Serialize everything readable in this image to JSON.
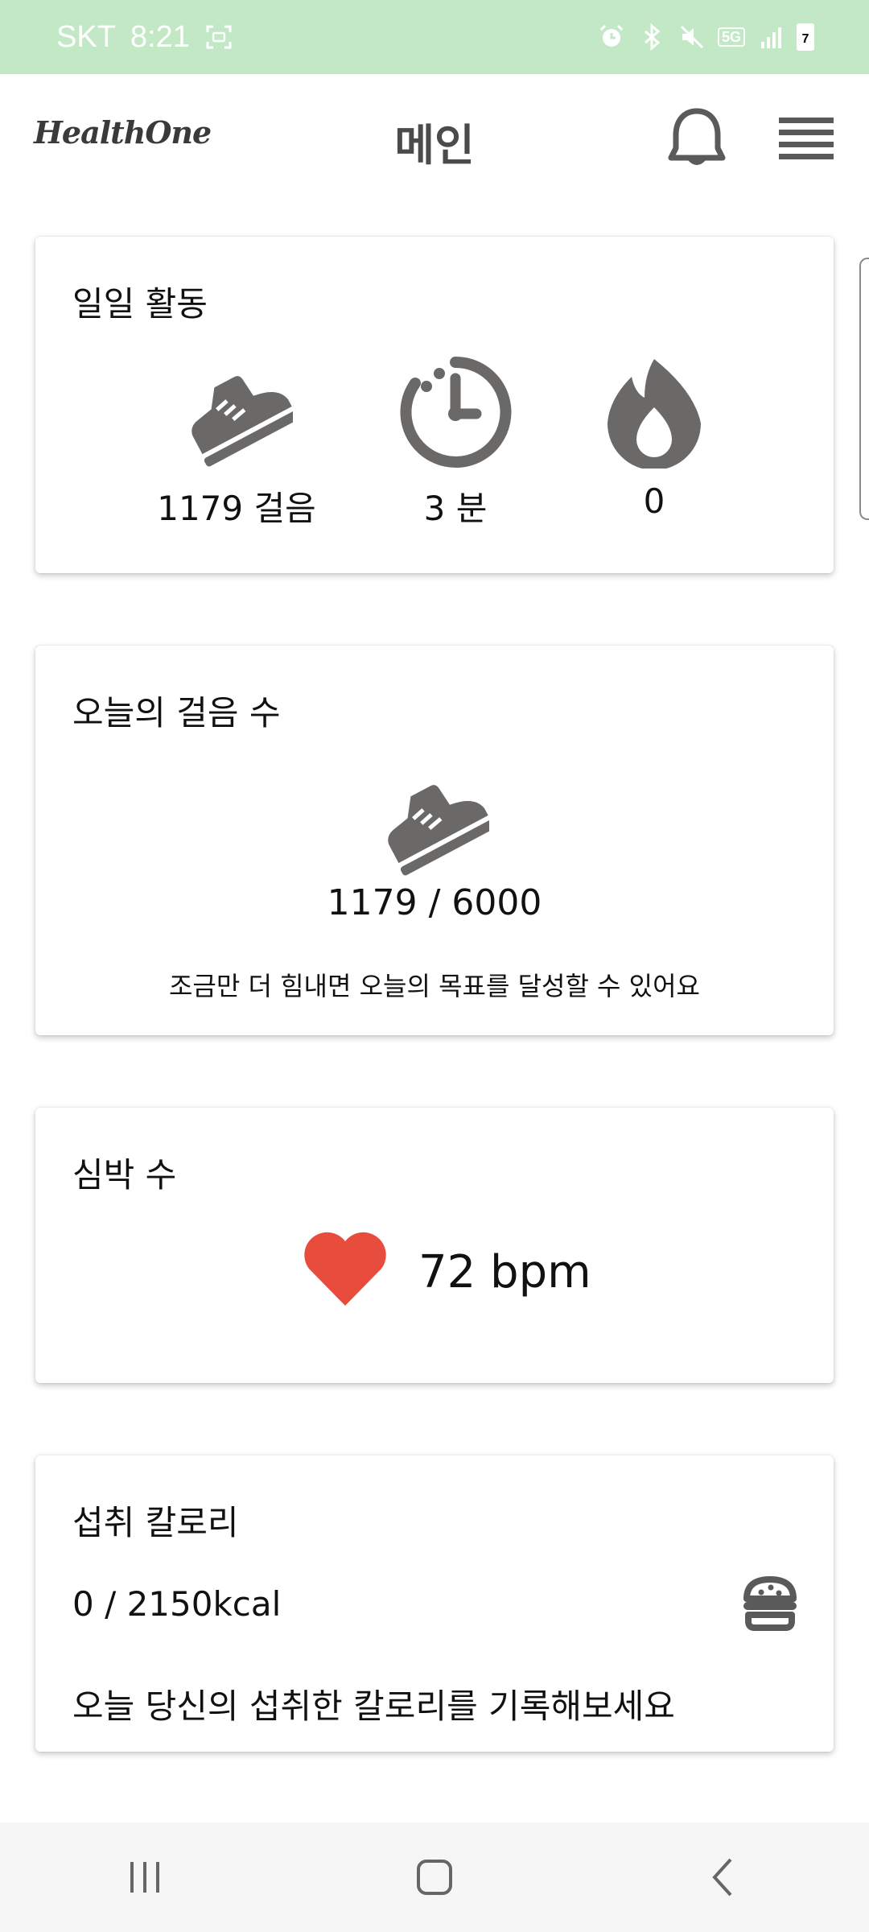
{
  "status_bar": {
    "carrier": "SKT",
    "time": "8:21",
    "network": "5G",
    "battery": "7"
  },
  "app": {
    "logo": "HealthOne",
    "title": "메인"
  },
  "icons": {
    "notifications": "bell-icon",
    "menu": "hamburger-menu-icon",
    "steps": "sneaker-icon",
    "time": "timer-icon",
    "calories": "flame-icon",
    "heart": "heart-icon",
    "food": "burger-icon"
  },
  "colors": {
    "status_bar": "#c3e8c6",
    "icon_gray": "#6b6868",
    "heart_red": "#e84c3d"
  },
  "daily_activity": {
    "title": "일일 활동",
    "steps": "1179 걸음",
    "minutes": "3 분",
    "calories": "0"
  },
  "today_steps": {
    "title": "오늘의 걸음 수",
    "value": "1179 / 6000",
    "message": "조금만 더 힘내면 오늘의 목표를 달성할 수 있어요"
  },
  "heart_rate": {
    "title": "심박 수",
    "value": "72 bpm"
  },
  "intake_calories": {
    "title": "섭취 칼로리",
    "value": "0 / 2150kcal",
    "message": "오늘 당신의 섭취한 칼로리를 기록해보세요"
  }
}
